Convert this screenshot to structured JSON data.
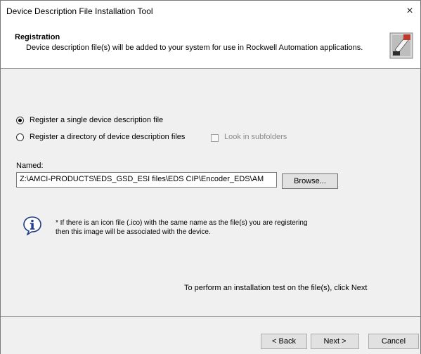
{
  "window": {
    "title": "Device Description File Installation Tool",
    "close_glyph": "×"
  },
  "header": {
    "title": "Registration",
    "subtitle": "Device description file(s) will be added to your system for use in Rockwell Automation applications.",
    "icon": "eds-wizard-icon"
  },
  "options": {
    "single": {
      "label": "Register a single device description file",
      "selected": true
    },
    "directory": {
      "label": "Register a directory of device description files",
      "selected": false
    },
    "subfolders": {
      "label": "Look in subfolders",
      "checked": false,
      "enabled": false
    }
  },
  "named": {
    "label": "Named:",
    "value": "Z:\\AMCI-PRODUCTS\\EDS_GSD_ESI files\\EDS CIP\\Encoder_EDS\\AM",
    "browse_label": "Browse..."
  },
  "info": {
    "icon": "info-icon",
    "text_line1": "* If there is an icon file (.ico) with the same name as the file(s) you are registering",
    "text_line2": "then this image will be associated with the device."
  },
  "hint": "To perform an installation test on the file(s), click Next",
  "buttons": {
    "back": "< Back",
    "next": "Next >",
    "cancel": "Cancel"
  }
}
